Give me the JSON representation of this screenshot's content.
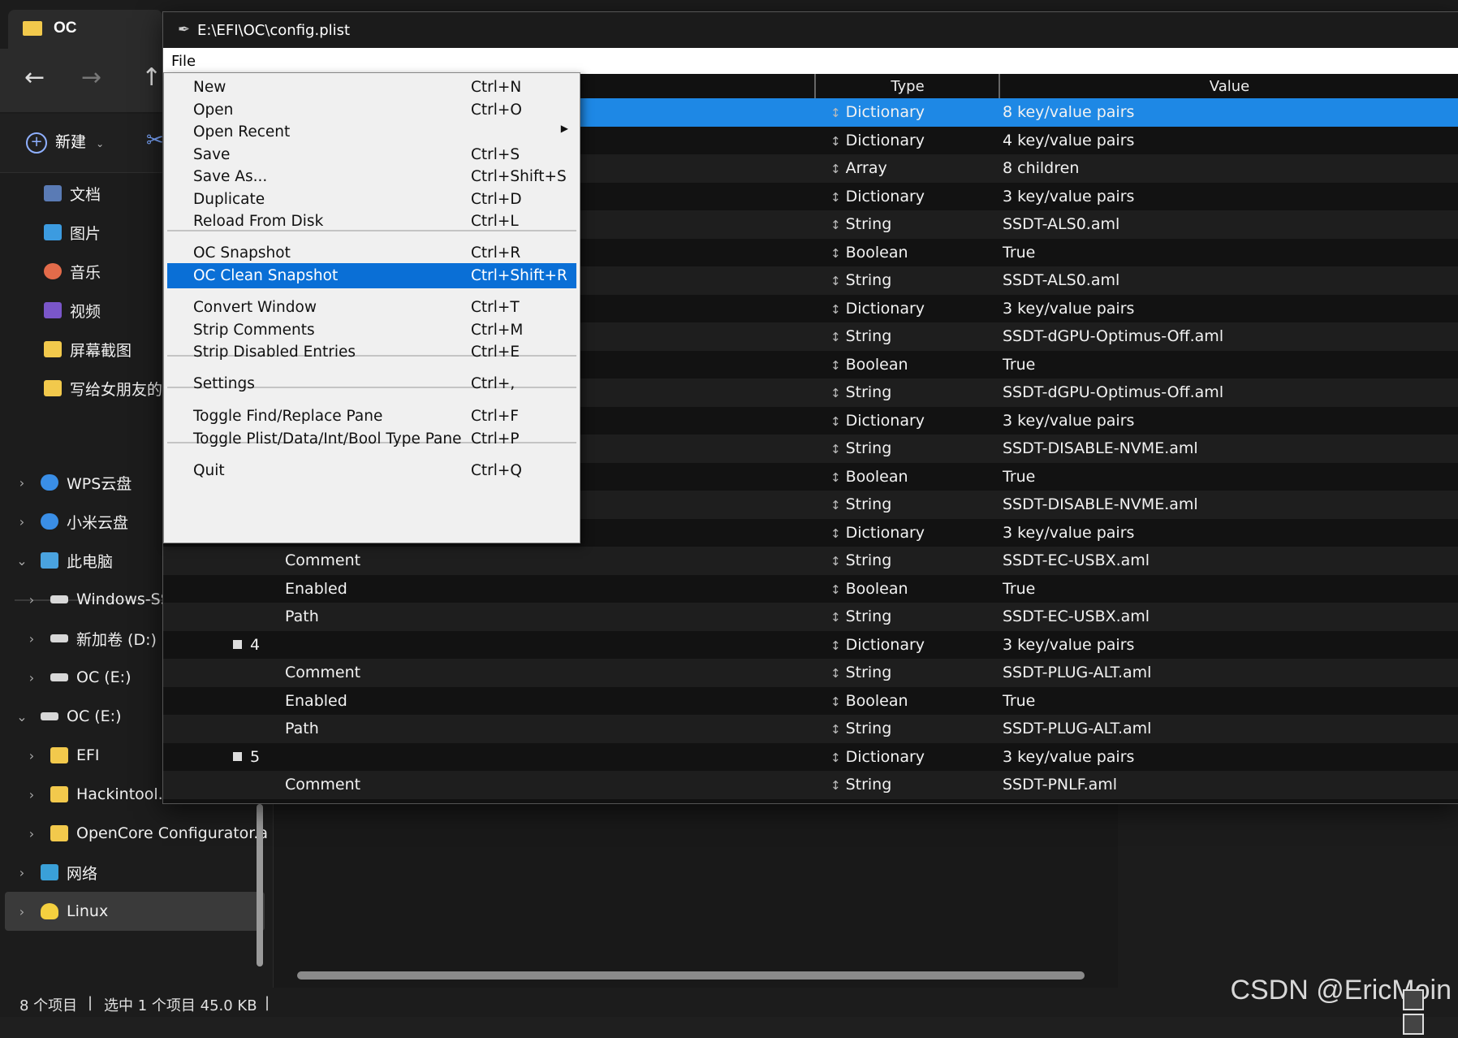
{
  "explorer": {
    "tab_title": "OC",
    "new_label": "新建",
    "sidebar": [
      {
        "label": "文档",
        "icon": "document-icon"
      },
      {
        "label": "图片",
        "icon": "pictures-icon"
      },
      {
        "label": "音乐",
        "icon": "music-icon"
      },
      {
        "label": "视频",
        "icon": "video-icon"
      },
      {
        "label": "屏幕截图",
        "icon": "folder-icon"
      },
      {
        "label": "写给女朋友的C",
        "icon": "folder-icon"
      },
      {
        "label": "WPS云盘",
        "icon": "cloud-icon"
      },
      {
        "label": "小米云盘",
        "icon": "cloud-icon"
      },
      {
        "label": "此电脑",
        "icon": "computer-icon"
      },
      {
        "label": "Windows-SS",
        "icon": "drive-icon"
      },
      {
        "label": "新加卷 (D:)",
        "icon": "drive-icon"
      },
      {
        "label": "OC (E:)",
        "icon": "drive-icon"
      },
      {
        "label": "OC (E:)",
        "icon": "drive-icon"
      },
      {
        "label": "EFI",
        "icon": "folder-icon"
      },
      {
        "label": "Hackintool.a",
        "icon": "folder-icon"
      },
      {
        "label": "OpenCore Configurator.a",
        "icon": "folder-icon"
      },
      {
        "label": "网络",
        "icon": "network-icon"
      },
      {
        "label": "Linux",
        "icon": "linux-icon"
      }
    ],
    "status": {
      "count": "8 个项目",
      "selection": "选中 1 个项目  45.0 KB"
    },
    "watermark": "CSDN @EricMoin"
  },
  "propertree": {
    "title": "E:\\EFI\\OC\\config.plist",
    "menubar": [
      "File"
    ],
    "columns": {
      "type": "Type",
      "value": "Value"
    },
    "rows": [
      {
        "key": "",
        "type": "Dictionary",
        "value": "8 key/value pairs"
      },
      {
        "key": "",
        "type": "Dictionary",
        "value": "4 key/value pairs"
      },
      {
        "key": "",
        "type": "Array",
        "value": "8 children"
      },
      {
        "key": "",
        "type": "Dictionary",
        "value": "3 key/value pairs"
      },
      {
        "key": "",
        "type": "String",
        "value": "SSDT-ALS0.aml"
      },
      {
        "key": "",
        "type": "Boolean",
        "value": "True"
      },
      {
        "key": "",
        "type": "String",
        "value": "SSDT-ALS0.aml"
      },
      {
        "key": "",
        "type": "Dictionary",
        "value": "3 key/value pairs"
      },
      {
        "key": "",
        "type": "String",
        "value": "SSDT-dGPU-Optimus-Off.aml"
      },
      {
        "key": "",
        "type": "Boolean",
        "value": "True"
      },
      {
        "key": "",
        "type": "String",
        "value": "SSDT-dGPU-Optimus-Off.aml"
      },
      {
        "key": "",
        "type": "Dictionary",
        "value": "3 key/value pairs"
      },
      {
        "key": "",
        "type": "String",
        "value": "SSDT-DISABLE-NVME.aml"
      },
      {
        "key": "",
        "type": "Boolean",
        "value": "True"
      },
      {
        "key": "",
        "type": "String",
        "value": "SSDT-DISABLE-NVME.aml"
      },
      {
        "key": "",
        "type": "Dictionary",
        "value": "3 key/value pairs"
      },
      {
        "key": "Comment",
        "type": "String",
        "value": "SSDT-EC-USBX.aml"
      },
      {
        "key": "Enabled",
        "type": "Boolean",
        "value": "True"
      },
      {
        "key": "Path",
        "type": "String",
        "value": "SSDT-EC-USBX.aml"
      },
      {
        "key": "4",
        "type": "Dictionary",
        "value": "3 key/value pairs"
      },
      {
        "key": "Comment",
        "type": "String",
        "value": "SSDT-PLUG-ALT.aml"
      },
      {
        "key": "Enabled",
        "type": "Boolean",
        "value": "True"
      },
      {
        "key": "Path",
        "type": "String",
        "value": "SSDT-PLUG-ALT.aml"
      },
      {
        "key": "5",
        "type": "Dictionary",
        "value": "3 key/value pairs"
      },
      {
        "key": "Comment",
        "type": "String",
        "value": "SSDT-PNLF.aml"
      }
    ],
    "file_menu": [
      {
        "label": "New",
        "shortcut": "Ctrl+N"
      },
      {
        "label": "Open",
        "shortcut": "Ctrl+O"
      },
      {
        "label": "Open Recent",
        "shortcut": ""
      },
      {
        "label": "Save",
        "shortcut": "Ctrl+S"
      },
      {
        "label": "Save As...",
        "shortcut": "Ctrl+Shift+S"
      },
      {
        "label": "Duplicate",
        "shortcut": "Ctrl+D"
      },
      {
        "label": "Reload From Disk",
        "shortcut": "Ctrl+L"
      },
      {
        "label": "OC Snapshot",
        "shortcut": "Ctrl+R"
      },
      {
        "label": "OC Clean Snapshot",
        "shortcut": "Ctrl+Shift+R"
      },
      {
        "label": "Convert Window",
        "shortcut": "Ctrl+T"
      },
      {
        "label": "Strip Comments",
        "shortcut": "Ctrl+M"
      },
      {
        "label": "Strip Disabled Entries",
        "shortcut": "Ctrl+E"
      },
      {
        "label": "Settings",
        "shortcut": "Ctrl+,"
      },
      {
        "label": "Toggle Find/Replace Pane",
        "shortcut": "Ctrl+F"
      },
      {
        "label": "Toggle Plist/Data/Int/Bool Type Pane",
        "shortcut": "Ctrl+P"
      },
      {
        "label": "Quit",
        "shortcut": "Ctrl+Q"
      }
    ]
  }
}
